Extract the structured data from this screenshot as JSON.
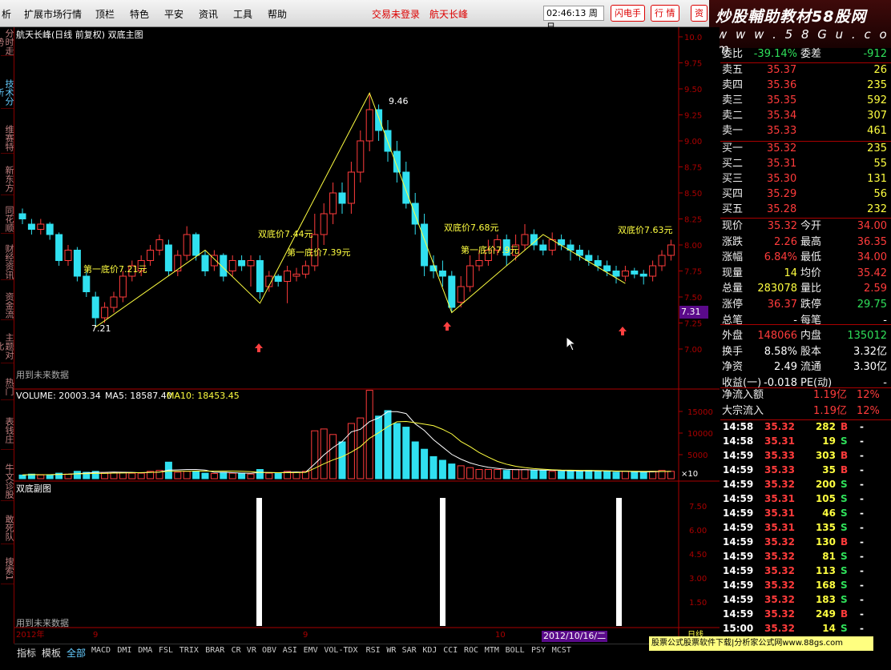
{
  "menu": {
    "items": [
      "析",
      "扩展市场行情",
      "顶栏",
      "特色",
      "平安",
      "资讯",
      "工具",
      "帮助"
    ],
    "warn1": "交易未登录",
    "warn2": "航天长峰",
    "clock": "02:46:13 周日",
    "btn1": "闪电手",
    "btn2": "行 情",
    "btn3": "资"
  },
  "brand": {
    "line1": "炒股輔助教材58股网",
    "line2": "w w w . 5 8 G u . c o m"
  },
  "lefttabs": [
    "分时走势",
    "技术分析",
    "维赛特",
    "新东方",
    "同花顺",
    "财经资讯",
    "资金流",
    "主题对比",
    "热门",
    "表钱庄",
    "牛文诊股",
    "敢死队",
    "搜索1"
  ],
  "chart": {
    "title": "航天长峰(日线 前复权) 双底主图",
    "note": "用到未来数据",
    "subtitle": "双底副图",
    "subnote": "用到未来数据",
    "volume_label": "VOLUME: 20003.34",
    "ma5": "MA5: 18587.40",
    "ma10": "MA10: 18453.45",
    "price_tag": "7.31",
    "date_flag": "2012/10/16/二",
    "year_label": "2012年",
    "month9": "9",
    "month10": "10",
    "x10": "×10",
    "rizhou": "日线",
    "annotations": [
      {
        "text": "第一底价7.21元"
      },
      {
        "text": "7.21"
      },
      {
        "text": "双底价7.44元"
      },
      {
        "text": "第一底价7.39元"
      },
      {
        "text": "9.46"
      },
      {
        "text": "双底价7.68元"
      },
      {
        "text": "第一底价7.9元"
      },
      {
        "text": "双底价7.63元"
      }
    ],
    "price_ticks": [
      "10.0",
      "9.75",
      "9.50",
      "9.25",
      "9.00",
      "8.75",
      "8.50",
      "8.25",
      "8.00",
      "7.75",
      "7.50",
      "7.25",
      "7.00"
    ],
    "vol_ticks": [
      "15000",
      "10000",
      "5000"
    ],
    "sub_ticks": [
      "7.50",
      "6.00",
      "4.50",
      "3.00",
      "1.50"
    ],
    "indicators": [
      "指标",
      "模板",
      "全部",
      "MACD",
      "DMI",
      "DMA",
      "FSL",
      "TRIX",
      "BRAR",
      "CR",
      "VR",
      "OBV",
      "ASI",
      "EMV",
      "VOL-TDX",
      "RSI",
      "WR",
      "SAR",
      "KDJ",
      "CCI",
      "ROC",
      "MTM",
      "BOLL",
      "PSY",
      "MCST"
    ]
  },
  "quote": {
    "weibi": {
      "label": "委比",
      "val": "-39.14%",
      "label2": "委差",
      "val2": "-912"
    },
    "sells": [
      {
        "label": "卖五",
        "price": "35.37",
        "vol": "26"
      },
      {
        "label": "卖四",
        "price": "35.36",
        "vol": "235"
      },
      {
        "label": "卖三",
        "price": "35.35",
        "vol": "592"
      },
      {
        "label": "卖二",
        "price": "35.34",
        "vol": "307"
      },
      {
        "label": "卖一",
        "price": "35.33",
        "vol": "461"
      }
    ],
    "buys": [
      {
        "label": "买一",
        "price": "35.32",
        "vol": "235"
      },
      {
        "label": "买二",
        "price": "35.31",
        "vol": "55"
      },
      {
        "label": "买三",
        "price": "35.30",
        "vol": "131"
      },
      {
        "label": "买四",
        "price": "35.29",
        "vol": "56"
      },
      {
        "label": "买五",
        "price": "35.28",
        "vol": "232"
      }
    ],
    "stats": [
      {
        "l1": "现价",
        "v1": "35.32",
        "l2": "今开",
        "v2": "34.00",
        "c1": "red",
        "c2": "red"
      },
      {
        "l1": "涨跌",
        "v1": "2.26",
        "l2": "最高",
        "v2": "36.35",
        "c1": "red",
        "c2": "red"
      },
      {
        "l1": "涨幅",
        "v1": "6.84%",
        "l2": "最低",
        "v2": "34.00",
        "c1": "red",
        "c2": "red"
      },
      {
        "l1": "现量",
        "v1": "14",
        "l2": "均价",
        "v2": "35.42",
        "c1": "yel",
        "c2": "red"
      },
      {
        "l1": "总量",
        "v1": "283078",
        "l2": "量比",
        "v2": "2.59",
        "c1": "yel",
        "c2": "red"
      },
      {
        "l1": "涨停",
        "v1": "36.37",
        "l2": "跌停",
        "v2": "29.75",
        "c1": "red",
        "c2": "grn"
      },
      {
        "l1": "总笔",
        "v1": "-",
        "l2": "每笔",
        "v2": "-",
        "c1": "wht",
        "c2": "wht"
      },
      {
        "l1": "外盘",
        "v1": "148066",
        "l2": "内盘",
        "v2": "135012",
        "c1": "red",
        "c2": "grn"
      },
      {
        "l1": "换手",
        "v1": "8.58%",
        "l2": "股本",
        "v2": "3.32亿",
        "c1": "wht",
        "c2": "wht"
      },
      {
        "l1": "净资",
        "v1": "2.49",
        "l2": "流通",
        "v2": "3.30亿",
        "c1": "wht",
        "c2": "wht"
      },
      {
        "l1": "收益(一)",
        "v1": "-0.018",
        "l2": "PE(动)",
        "v2": "-",
        "c1": "wht",
        "c2": "wht"
      }
    ],
    "flow": [
      {
        "label": "净流入额",
        "val": "1.19亿",
        "pct": "12%"
      },
      {
        "label": "大宗流入",
        "val": "1.19亿",
        "pct": "12%"
      }
    ],
    "ticks": [
      {
        "t": "14:58",
        "p": "35.32",
        "v": "282",
        "d": "B"
      },
      {
        "t": "14:58",
        "p": "35.31",
        "v": "19",
        "d": "S"
      },
      {
        "t": "14:59",
        "p": "35.33",
        "v": "303",
        "d": "B"
      },
      {
        "t": "14:59",
        "p": "35.33",
        "v": "35",
        "d": "B"
      },
      {
        "t": "14:59",
        "p": "35.32",
        "v": "200",
        "d": "S"
      },
      {
        "t": "14:59",
        "p": "35.31",
        "v": "105",
        "d": "S"
      },
      {
        "t": "14:59",
        "p": "35.31",
        "v": "46",
        "d": "S"
      },
      {
        "t": "14:59",
        "p": "35.31",
        "v": "135",
        "d": "S"
      },
      {
        "t": "14:59",
        "p": "35.32",
        "v": "130",
        "d": "B"
      },
      {
        "t": "14:59",
        "p": "35.32",
        "v": "81",
        "d": "S"
      },
      {
        "t": "14:59",
        "p": "35.32",
        "v": "113",
        "d": "S"
      },
      {
        "t": "14:59",
        "p": "35.32",
        "v": "168",
        "d": "S"
      },
      {
        "t": "14:59",
        "p": "35.32",
        "v": "183",
        "d": "S"
      },
      {
        "t": "14:59",
        "p": "35.32",
        "v": "249",
        "d": "B"
      },
      {
        "t": "15:00",
        "p": "35.32",
        "v": "14",
        "d": "S"
      }
    ],
    "dash": "-"
  },
  "ad": "股票公式股票软件下载|分析家公式网www.88gs.com"
}
